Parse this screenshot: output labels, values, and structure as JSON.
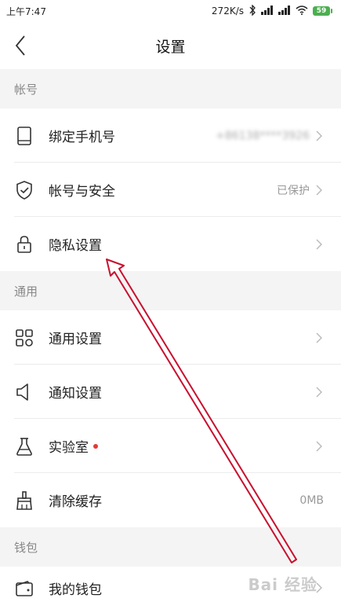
{
  "status_bar": {
    "time": "上午7:47",
    "network_speed": "272K/s",
    "battery_level": "59",
    "icons": [
      "bluetooth-icon",
      "signal-icon",
      "signal-icon",
      "wifi-icon",
      "battery-icon"
    ]
  },
  "nav": {
    "title": "设置",
    "back_icon": "chevron-left-icon"
  },
  "sections": {
    "account": {
      "header": "帐号",
      "items": [
        {
          "label": "绑定手机号",
          "value": "+86138****3926",
          "icon": "phone-icon"
        },
        {
          "label": "帐号与安全",
          "value": "已保护",
          "icon": "shield-icon"
        },
        {
          "label": "隐私设置",
          "value": "",
          "icon": "lock-icon"
        }
      ]
    },
    "general": {
      "header": "通用",
      "items": [
        {
          "label": "通用设置",
          "value": "",
          "icon": "grid-icon"
        },
        {
          "label": "通知设置",
          "value": "",
          "icon": "speaker-icon"
        },
        {
          "label": "实验室",
          "value": "",
          "icon": "flask-icon",
          "badge": "red-dot"
        },
        {
          "label": "清除缓存",
          "value": "0MB",
          "icon": "broom-icon"
        }
      ]
    },
    "wallet": {
      "header": "钱包",
      "items": [
        {
          "label": "我的钱包",
          "value": "",
          "icon": "wallet-icon"
        }
      ]
    }
  },
  "watermark": "Bai 经验",
  "colors": {
    "annotation_arrow": "#c8102e",
    "section_bg": "#f4f4f4",
    "badge": "#e53935",
    "battery": "#4caf50"
  }
}
